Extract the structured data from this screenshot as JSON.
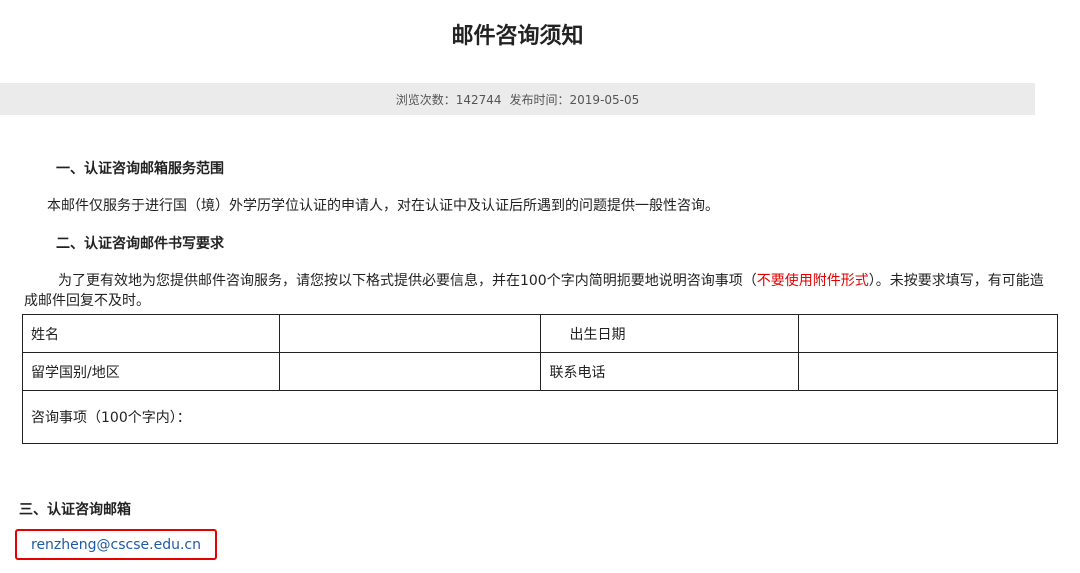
{
  "page": {
    "title": "邮件咨询须知",
    "meta": {
      "views": "浏览次数：142744",
      "publish_date": "发布时间：2019-05-05"
    }
  },
  "section1": {
    "heading": "一、认证咨询邮箱服务范围",
    "body": "本邮件仅服务于进行国（境）外学历学位认证的申请人，对在认证中及认证后所遇到的问题提供一般性咨询。"
  },
  "section2": {
    "heading": "二、认证咨询邮件书写要求",
    "body_before": "为了更有效地为您提供邮件咨询服务，请您按以下格式提供必要信息，并在100个字内简明扼要地说明咨询事项（",
    "body_highlight": "不要使用附件形式",
    "body_after": "）。未按要求填写，有可能造成邮件回复不及时。",
    "form": {
      "row1": [
        "姓名",
        "",
        "出生日期",
        ""
      ],
      "row2": [
        "留学国别/地区",
        "",
        "联系电话",
        ""
      ],
      "row3": "咨询事项（100个字内）："
    }
  },
  "section3": {
    "heading": "三、认证咨询邮箱",
    "email": "renzheng@cscse.edu.cn"
  },
  "colors": {
    "highlight_red": "#e30000",
    "link_blue": "#1f5aa8",
    "meta_bar_bg": "#ebebeb",
    "callout_border": "#e60000"
  }
}
